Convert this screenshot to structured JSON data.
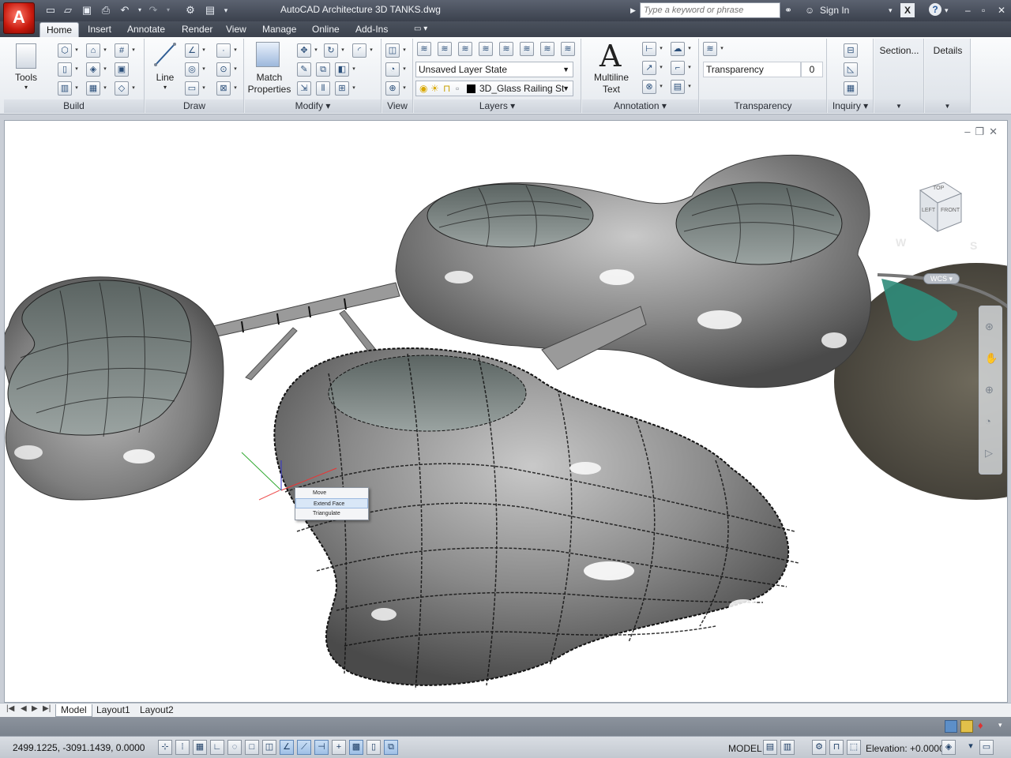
{
  "app": {
    "logo_letter": "A",
    "title": "AutoCAD Architecture   3D TANKS.dwg",
    "search_placeholder": "Type a keyword or phrase",
    "sign_in": "Sign In"
  },
  "tabs": [
    "Home",
    "Insert",
    "Annotate",
    "Render",
    "View",
    "Manage",
    "Online",
    "Add-Ins"
  ],
  "ribbon": {
    "tools_label": "Tools",
    "panels": {
      "build": "Build",
      "draw": "Draw",
      "modify": "Modify ▾",
      "view": "View",
      "layers": "Layers ▾",
      "annotation": "Annotation ▾",
      "transparency": "Transparency",
      "inquiry": "Inquiry ▾"
    },
    "line_label": "Line",
    "match_properties": "Match Properties",
    "layer_state": "Unsaved Layer State",
    "layer_name": "3D_Glass Railing St",
    "multiline_label": "Multiline Text",
    "transparency_field": "Transparency",
    "transparency_value": "0",
    "section_label": "Section...",
    "details_label": "Details"
  },
  "viewcube": {
    "top": "TOP",
    "front": "FRONT",
    "left": "LEFT",
    "w": "W",
    "s": "S",
    "wcs": "WCS"
  },
  "context_menu": [
    "Move",
    "Extend Face",
    "Triangulate"
  ],
  "layout_tabs": [
    "Model",
    "Layout1",
    "Layout2"
  ],
  "status": {
    "coords": "2499.1225, -3091.1439, 0.0000",
    "model": "MODEL",
    "elevation": "Elevation: +0.0000"
  },
  "colors": {
    "accent": "#c8190d",
    "ribbon_bg": "#e5e9ee",
    "viewport_bg": "#ffffff"
  }
}
